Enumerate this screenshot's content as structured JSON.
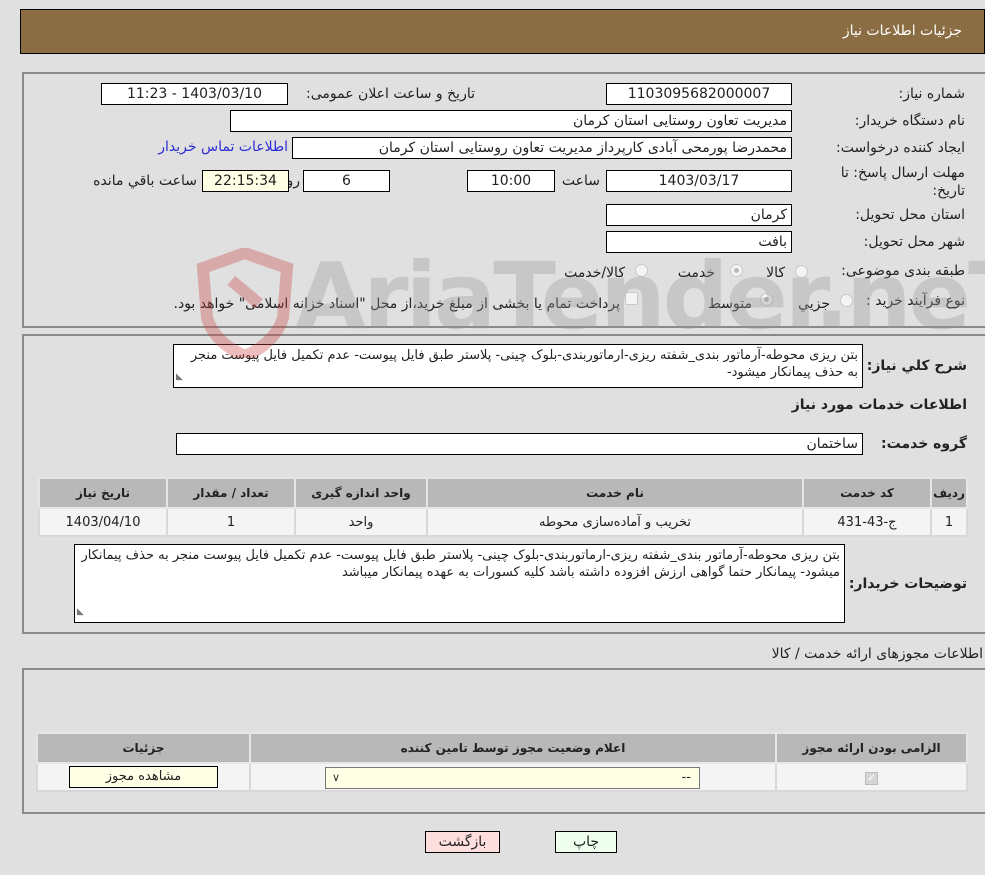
{
  "header": {
    "title": "جزئیات اطلاعات نیاز"
  },
  "form": {
    "need_number": {
      "label": "شماره نیاز:",
      "value": "1103095682000007"
    },
    "announce_datetime": {
      "label": "تاریخ و ساعت اعلان عمومی:",
      "value": "1403/03/10 - 11:23"
    },
    "buyer_org": {
      "label": "نام دستگاه خریدار:",
      "value": "مدیریت تعاون روستایی استان کرمان"
    },
    "requester": {
      "label": "ایجاد کننده درخواست:",
      "value": "محمدرضا پورمحی آبادی کارپرداز مدیریت تعاون روستایی استان کرمان"
    },
    "buyer_contact_link": "اطلاعات تماس خریدار",
    "deadline": {
      "label_line1": "مهلت ارسال پاسخ: تا",
      "label_line2": "تاریخ:",
      "date": "1403/03/17",
      "time_label": "ساعت",
      "time": "10:00",
      "days": "6",
      "days_label": "روز و",
      "remaining": "22:15:34",
      "remaining_label": "ساعت باقي مانده"
    },
    "province": {
      "label": "استان محل تحویل:",
      "value": "کرمان"
    },
    "city": {
      "label": "شهر محل تحویل:",
      "value": "بافت"
    },
    "category": {
      "label": "طبقه بندی موضوعی:",
      "options": [
        {
          "label": "کالا",
          "selected": false
        },
        {
          "label": "خدمت",
          "selected": true
        },
        {
          "label": "کالا/خدمت",
          "selected": false
        }
      ]
    },
    "purchase_type": {
      "label": "نوع فرآیند خرید :",
      "options": [
        {
          "label": "جزيي",
          "selected": false
        },
        {
          "label": "متوسط",
          "selected": true
        }
      ],
      "treasury_checkbox_label": "پرداخت تمام یا بخشی از مبلغ خرید،از محل \"اسناد خزانه اسلامی\" خواهد بود."
    }
  },
  "summary": {
    "label": "شرح کلي نياز:",
    "text": "بتن ریزی محوطه-آرماتور بندی_شفته ریزی-ارماتوربندی-بلوک چینی- پلاستر طبق فایل پیوست- عدم تکمیل فایل پیوست منجر به حذف پیمانکار میشود-"
  },
  "services": {
    "section_title": "اطلاعات خدمات مورد نياز",
    "group_label": "گروه خدمت:",
    "group_value": "ساختمان",
    "table": {
      "headers": [
        "ردیف",
        "کد خدمت",
        "نام خدمت",
        "واحد اندازه گیری",
        "تعداد / مقدار",
        "تاریخ نیاز"
      ],
      "rows": [
        [
          "1",
          "ج-43-431",
          "تخریب و آماده‌سازی محوطه",
          "واحد",
          "1",
          "1403/04/10"
        ]
      ]
    }
  },
  "buyer_notes": {
    "label": "توضیحات خریدار:",
    "text": "بتن ریزی محوطه-آرماتور بندی_شفته ریزی-ارماتوربندی-بلوک چینی- پلاستر طبق فایل پیوست- عدم تکمیل فایل پیوست منجر به حذف پیمانکار میشود- پیمانکار حتما گواهی ارزش افزوده داشته باشد کلیه کسورات به عهده پیمانکار میباشد"
  },
  "permits": {
    "section_title": "اطلاعات مجوزهای ارائه خدمت / کالا",
    "table": {
      "headers": [
        "الزامی بودن ارائه مجوز",
        "اعلام وضعیت مجوز توسط تامین کننده",
        "جزئیات"
      ],
      "row": {
        "required_checked": true,
        "status_value": "--",
        "details_button": "مشاهده مجوز"
      }
    }
  },
  "footer": {
    "print_button": "چاپ",
    "back_button": "بازگشت"
  },
  "watermark": {
    "text": "AriaTender.neT"
  },
  "colors": {
    "header_bg": "#8b6d43",
    "link": "#2b2bd6",
    "back_btn_bg": "#ffdede",
    "print_btn_bg": "#eeffee"
  }
}
